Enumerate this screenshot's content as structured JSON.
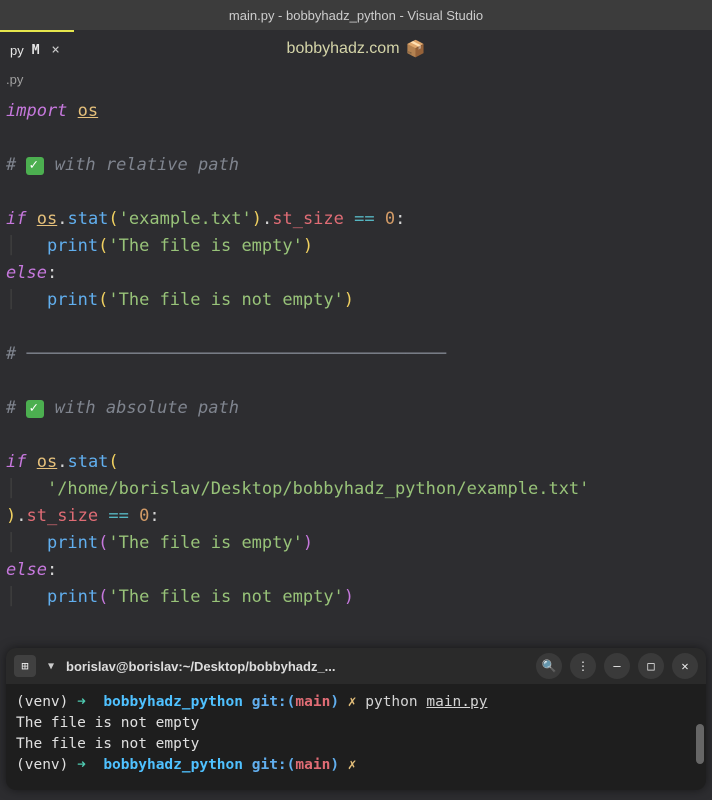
{
  "window": {
    "title": "main.py - bobbyhadz_python - Visual Studio"
  },
  "tab": {
    "label": "py",
    "modified": "M",
    "close": "×"
  },
  "watermark": {
    "text": "bobbyhadz.com",
    "emoji": "📦"
  },
  "breadcrumb": {
    "text": ".py"
  },
  "code": {
    "import_kw": "import",
    "os": "os",
    "comment1_prefix": "# ",
    "comment1_text": " with relative path",
    "if_kw": "if",
    "stat": "stat",
    "file_rel": "'example.txt'",
    "st_size": "st_size",
    "eqeq": "==",
    "zero": "0",
    "colon": ":",
    "print": "print",
    "empty_msg": "'The file is empty'",
    "else_kw": "else",
    "notempty_msg": "'The file is not empty'",
    "comment_sep": "# ",
    "sep_line": "─────────────────────────────────────────",
    "comment2_text": " with absolute path",
    "file_abs": "'/home/borislav/Desktop/bobbyhadz_python/example.txt'",
    "close_stat": ").",
    "dot": "."
  },
  "terminal": {
    "title": "borislav@borislav:~/Desktop/bobbyhadz_...",
    "newtab_icon": "⊞",
    "dropdown_icon": "▼",
    "search_icon": "🔍",
    "menu_icon": "⋮",
    "minimize_icon": "—",
    "maximize_icon": "□",
    "close_icon": "✕",
    "venv_label": "(venv) ",
    "arrow": "➜",
    "dir": "bobbyhadz_python",
    "git_prefix": "git:(",
    "branch": "main",
    "git_suffix": ")",
    "x_mark": "✗",
    "cmd": " python ",
    "cmd_file": "main.py",
    "output1": "The file is not empty",
    "output2": "The file is not empty"
  }
}
